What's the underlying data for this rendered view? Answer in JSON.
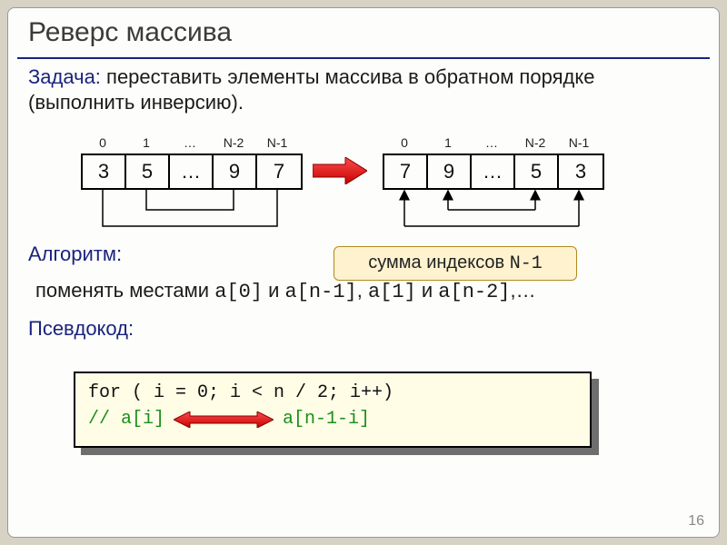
{
  "title": "Реверс массива",
  "task": {
    "label": "Задача:",
    "text": " переставить элементы массива в обратном порядке (выполнить инверсию)."
  },
  "indices": [
    "0",
    "1",
    "…",
    "N-2",
    "N-1"
  ],
  "array_left": [
    "3",
    "5",
    "…",
    "9",
    "7"
  ],
  "array_right": [
    "7",
    "9",
    "…",
    "5",
    "3"
  ],
  "algorithm": {
    "label": "Алгоритм:",
    "swap_prefix": "поменять местами ",
    "swap_a": "a[0]",
    "swap_and1": " и ",
    "swap_b": "a[n-1]",
    "swap_comma": ", ",
    "swap_c": "a[1]",
    "swap_and2": " и ",
    "swap_d": "a[n-2]",
    "swap_tail": ",…"
  },
  "hint": {
    "text_prefix": "сумма индексов ",
    "code": "N-1"
  },
  "pseudocode_label": "Псевдокод:",
  "code": {
    "line1": "for ( i = 0; i < n / 2; i++)",
    "comment_left": " // a[i]",
    "comment_right": "a[n-1-i]"
  },
  "page_number": "16",
  "colors": {
    "accent": "#d32f2f",
    "heading": "#1a237e",
    "hint_bg": "#fff2cf",
    "code_bg": "#fffde6"
  }
}
